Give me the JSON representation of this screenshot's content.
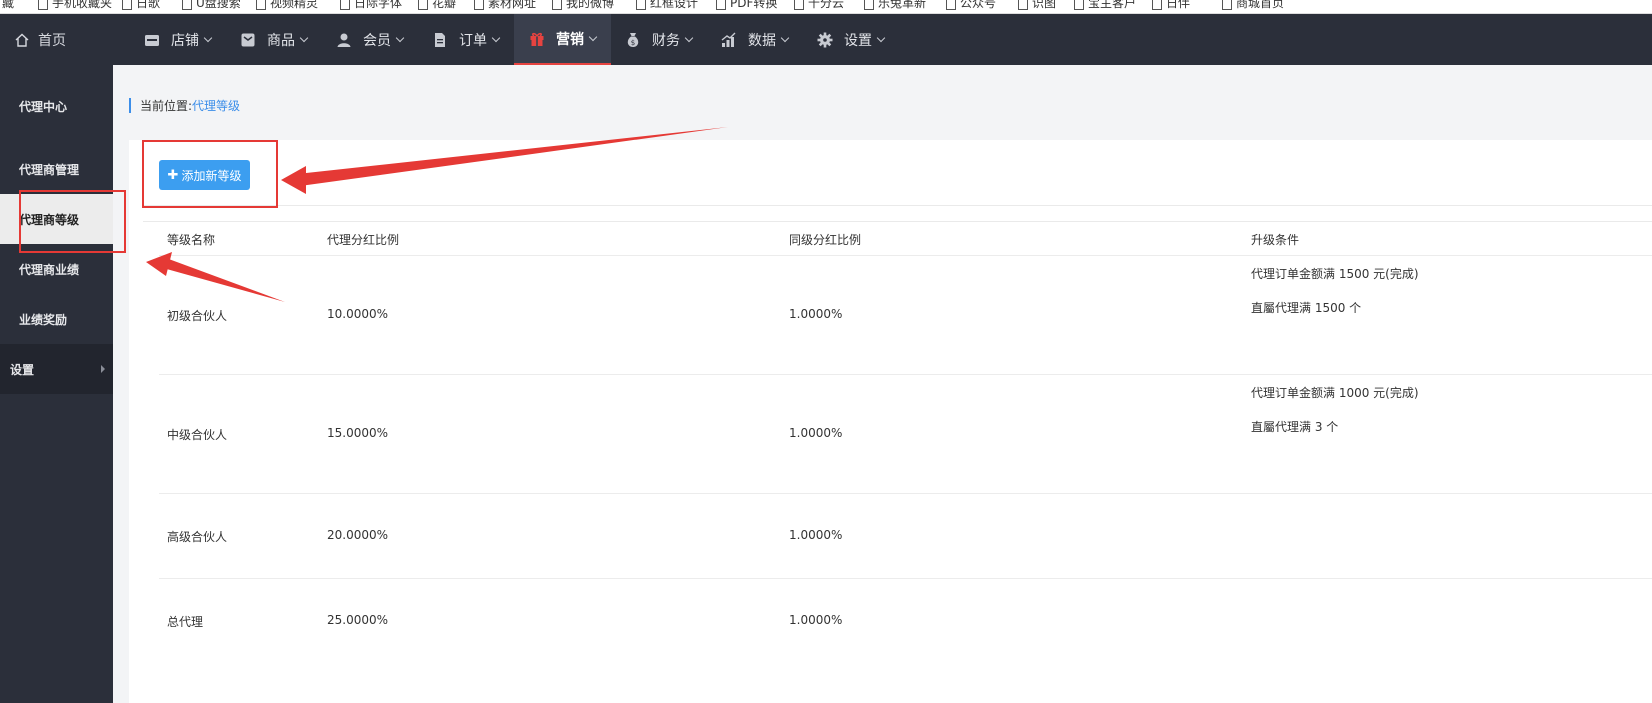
{
  "bookmarks": [
    "藏",
    "手机收藏夹",
    "日歌",
    "U盘搜索",
    "视频精灵",
    "日际字体",
    "花瓣",
    "素材网址",
    "我的微博",
    "红框设计",
    "PDF转换",
    "千分云",
    "乐兔革新",
    "公众号",
    "识图",
    "宝主客户",
    "日伴",
    "商城首页"
  ],
  "topnav": {
    "home_label": "首页",
    "items": [
      {
        "label": "店铺",
        "icon": "store-icon"
      },
      {
        "label": "商品",
        "icon": "goods-icon"
      },
      {
        "label": "会员",
        "icon": "user-icon"
      },
      {
        "label": "订单",
        "icon": "order-icon"
      },
      {
        "label": "营销",
        "icon": "gift-icon",
        "active": true
      },
      {
        "label": "财务",
        "icon": "money-bag-icon"
      },
      {
        "label": "数据",
        "icon": "chart-icon"
      },
      {
        "label": "设置",
        "icon": "gear-icon"
      }
    ]
  },
  "sidebar": {
    "items": [
      {
        "label": "代理中心"
      },
      {
        "label": "代理商管理"
      },
      {
        "label": "代理商等级",
        "active": true
      },
      {
        "label": "代理商业绩"
      },
      {
        "label": "业绩奖励"
      },
      {
        "label": "设置"
      }
    ]
  },
  "breadcrumb": {
    "prefix": "当前位置:",
    "current": "代理等级"
  },
  "toolbar": {
    "add_label": "添加新等级"
  },
  "table": {
    "headers": [
      "等级名称",
      "代理分红比例",
      "同级分红比例",
      "升级条件"
    ],
    "rows": [
      {
        "name": "初级合伙人",
        "ratio": "10.0000%",
        "peer": "1.0000%",
        "cond1": "代理订单金额满 1500 元(完成)",
        "cond2": "直屬代理满 1500 个"
      },
      {
        "name": "中级合伙人",
        "ratio": "15.0000%",
        "peer": "1.0000%",
        "cond1": "代理订单金额满 1000 元(完成)",
        "cond2": "直屬代理满 3 个"
      },
      {
        "name": "高级合伙人",
        "ratio": "20.0000%",
        "peer": "1.0000%",
        "cond1": "",
        "cond2": ""
      },
      {
        "name": "总代理",
        "ratio": "25.0000%",
        "peer": "1.0000%",
        "cond1": "",
        "cond2": ""
      }
    ]
  },
  "colors": {
    "nav_bg": "#2b2f3a",
    "accent": "#3c9ef0",
    "annotation": "#e53935"
  }
}
